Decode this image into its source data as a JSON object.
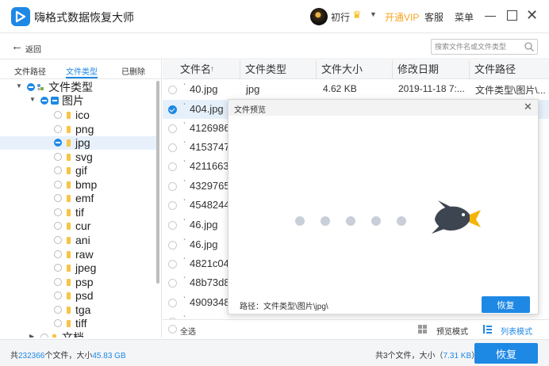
{
  "app": {
    "title": "嗨格式数据恢复大师"
  },
  "header": {
    "username": "初行",
    "vip_label": "开通VIP",
    "service_label": "客服",
    "menu_label": "菜单"
  },
  "toolbar": {
    "back_label": "返回",
    "search_placeholder": "搜索文件名或文件类型"
  },
  "sidebar": {
    "tabs": [
      "文件路径",
      "文件类型",
      "已删除"
    ],
    "active_tab": 1,
    "tree": [
      {
        "label": "文件类型",
        "level": 0,
        "expanded": true,
        "checked": "partial"
      },
      {
        "label": "图片",
        "level": 1,
        "expanded": true,
        "checked": "partial"
      },
      {
        "label": "ico",
        "level": 2,
        "checked": "none"
      },
      {
        "label": "png",
        "level": 2,
        "checked": "none"
      },
      {
        "label": "jpg",
        "level": 2,
        "checked": "partial",
        "selected": true
      },
      {
        "label": "svg",
        "level": 2,
        "checked": "none"
      },
      {
        "label": "gif",
        "level": 2,
        "checked": "none"
      },
      {
        "label": "bmp",
        "level": 2,
        "checked": "none"
      },
      {
        "label": "emf",
        "level": 2,
        "checked": "none"
      },
      {
        "label": "tif",
        "level": 2,
        "checked": "none"
      },
      {
        "label": "cur",
        "level": 2,
        "checked": "none"
      },
      {
        "label": "ani",
        "level": 2,
        "checked": "none"
      },
      {
        "label": "raw",
        "level": 2,
        "checked": "none"
      },
      {
        "label": "jpeg",
        "level": 2,
        "checked": "none"
      },
      {
        "label": "psp",
        "level": 2,
        "checked": "none"
      },
      {
        "label": "psd",
        "level": 2,
        "checked": "none"
      },
      {
        "label": "tga",
        "level": 2,
        "checked": "none"
      },
      {
        "label": "tiff",
        "level": 2,
        "checked": "none"
      },
      {
        "label": "文档",
        "level": 1,
        "expanded": false,
        "checked": "none"
      }
    ]
  },
  "table": {
    "columns": [
      "文件名",
      "文件类型",
      "文件大小",
      "修改日期",
      "文件路径"
    ],
    "rows": [
      {
        "name": "40.jpg",
        "type": "jpg",
        "size": "4.62 KB",
        "date": "2019-11-18 7:...",
        "path": "文件类型\\图片\\...",
        "checked": false
      },
      {
        "name": "404.jpg",
        "type": "",
        "size": "",
        "date": "",
        "path": "",
        "checked": true
      },
      {
        "name": "4126986",
        "checked": false
      },
      {
        "name": "4153747",
        "checked": false
      },
      {
        "name": "4211663",
        "checked": false
      },
      {
        "name": "4329765",
        "checked": false
      },
      {
        "name": "4548244",
        "checked": false
      },
      {
        "name": "46.jpg",
        "checked": false
      },
      {
        "name": "46.jpg",
        "checked": false
      },
      {
        "name": "4821c04",
        "checked": false
      },
      {
        "name": "48b73d8",
        "checked": false
      },
      {
        "name": "4909348",
        "checked": false
      },
      {
        "name": "",
        "checked": false
      }
    ],
    "select_all_label": "全选",
    "preview_mode_label": "预览模式",
    "list_mode_label": "列表模式"
  },
  "status": {
    "left_prefix": "共",
    "total_files": "232366",
    "left_mid": "个文件，大小",
    "total_size": "45.83 GB",
    "right_prefix": "共3个文件，大小（",
    "selected_size": "7.31 KB",
    "right_suffix": "）",
    "recover_label": "恢复"
  },
  "modal": {
    "title": "文件预览",
    "path_text": "路径：文件类型\\图片\\jpg\\",
    "recover_label": "恢复"
  },
  "colors": {
    "accent": "#1e88e5",
    "vip": "#f5a623"
  }
}
